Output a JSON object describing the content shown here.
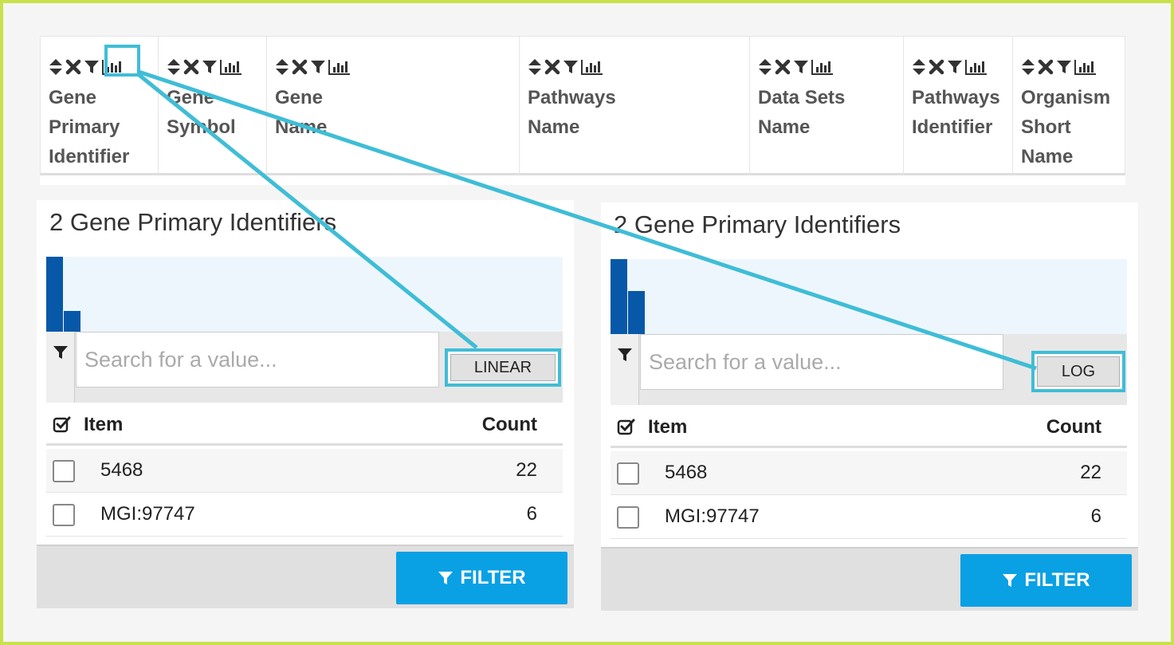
{
  "columns": [
    {
      "label": "Gene\nPrimary\nIdentifier"
    },
    {
      "label": "Gene\nSymbol"
    },
    {
      "label": "Gene\nName"
    },
    {
      "label": "Pathways\nName"
    },
    {
      "label": "Data Sets\nName"
    },
    {
      "label": "Pathways\nIdentifier"
    },
    {
      "label": "Organism\nShort\nName"
    }
  ],
  "column_icons": [
    "sort-icon",
    "remove-icon",
    "filter-icon",
    "histogram-icon"
  ],
  "panels": [
    {
      "title": "2 Gene Primary Identifiers",
      "search_placeholder": "Search for a value...",
      "scale_label": "LINEAR",
      "scale_value": "linear",
      "list_header": {
        "item": "Item",
        "count": "Count"
      },
      "rows": [
        {
          "item": "5468",
          "count": "22"
        },
        {
          "item": "MGI:97747",
          "count": "6"
        }
      ],
      "filter_label": "FILTER"
    },
    {
      "title": "2 Gene Primary Identifiers",
      "search_placeholder": "Search for a value...",
      "scale_label": "LOG",
      "scale_value": "log",
      "list_header": {
        "item": "Item",
        "count": "Count"
      },
      "rows": [
        {
          "item": "5468",
          "count": "22"
        },
        {
          "item": "MGI:97747",
          "count": "6"
        }
      ],
      "filter_label": "FILTER"
    }
  ],
  "colors": {
    "frame": "#c9e14c",
    "highlight": "#3fbdd6",
    "bar": "#0758a8",
    "histogram_bg": "#eef6fd",
    "filter_button": "#0aa0e4"
  }
}
